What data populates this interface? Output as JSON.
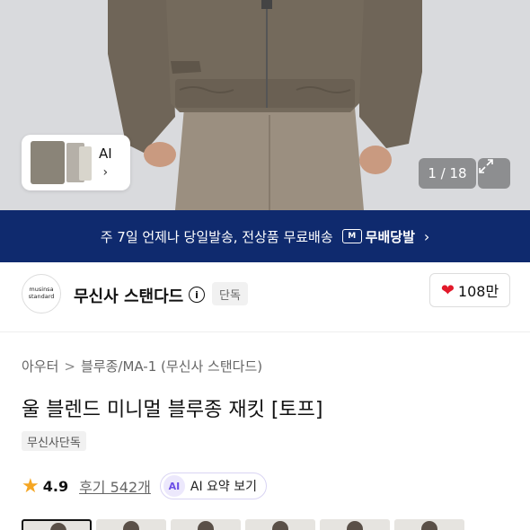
{
  "gallery": {
    "ai_card_label": "AI",
    "ai_card_chevron": "›",
    "counter": "1 / 18",
    "expand_icon": "expand-icon"
  },
  "banner": {
    "text": "주 7일 언제나 당일발송, 전상품 무료배송",
    "brand_badge": "M",
    "brand_label": "무배당발",
    "chevron": "›",
    "background": "#0f2a6e"
  },
  "brand": {
    "logo_line1": "musinsa",
    "logo_line2": "standard",
    "name": "무신사 스탠다드",
    "info_icon": "i",
    "tag": "단독",
    "likes": "108만",
    "heart_color": "#e2192a"
  },
  "breadcrumb": {
    "items": [
      "아우터",
      "블루종/MA-1 (무신사 스탠다드)"
    ],
    "separator": ">"
  },
  "product": {
    "title": "울 블렌드 미니멀 블루종 재킷 [토프]",
    "exclusive_badge": "무신사단독"
  },
  "rating": {
    "score": "4.9",
    "reviews": "후기 542개",
    "ai_icon": "AI",
    "ai_summary": "AI 요약 보기",
    "star_color": "#f5a623"
  },
  "thumbnails": {
    "count": 6,
    "selected_index": 0
  }
}
